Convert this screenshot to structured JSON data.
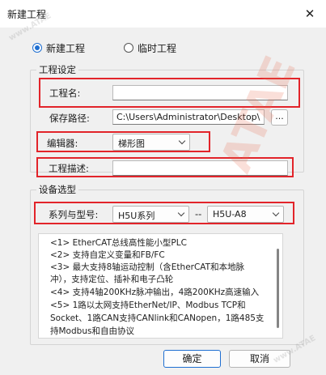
{
  "window": {
    "title": "新建工程",
    "close_label": "✕"
  },
  "mode": {
    "new_project": "新建工程",
    "temp_project": "临时工程",
    "selected": "new_project"
  },
  "project_settings": {
    "group_label": "工程设定",
    "name_label": "工程名:",
    "name_value": "",
    "path_label": "保存路径:",
    "path_value": "C:\\Users\\Administrator\\Desktop\\",
    "browse_label": "...",
    "editor_label": "编辑器:",
    "editor_value": "梯形图",
    "desc_label": "工程描述:",
    "desc_value": ""
  },
  "device": {
    "group_label": "设备选型",
    "series_label": "系列与型号:",
    "series_value": "H5U系列",
    "separator": "--",
    "model_value": "H5U-A8",
    "description_lines": [
      "<1> EtherCAT总线高性能小型PLC",
      "<2> 支持自定义变量和FB/FC",
      "<3> 最大支持8轴运动控制（含EtherCAT和本地脉",
      "冲），支持定位、插补和电子凸轮",
      "<4> 支持4轴200KHz脉冲输出，4路200KHz高速输入",
      "<5> 1路以太网支持EtherNet/IP、Modbus TCP和",
      "Socket、1路CAN支持CANlink和CANopen，1路485支",
      "持Modbus和自由协议"
    ]
  },
  "buttons": {
    "ok": "确定",
    "cancel": "取消"
  },
  "watermarks": [
    "ATAE",
    "www.ATAE"
  ],
  "colors": {
    "highlight": "#e2242a",
    "accent": "#1f6fd1"
  }
}
